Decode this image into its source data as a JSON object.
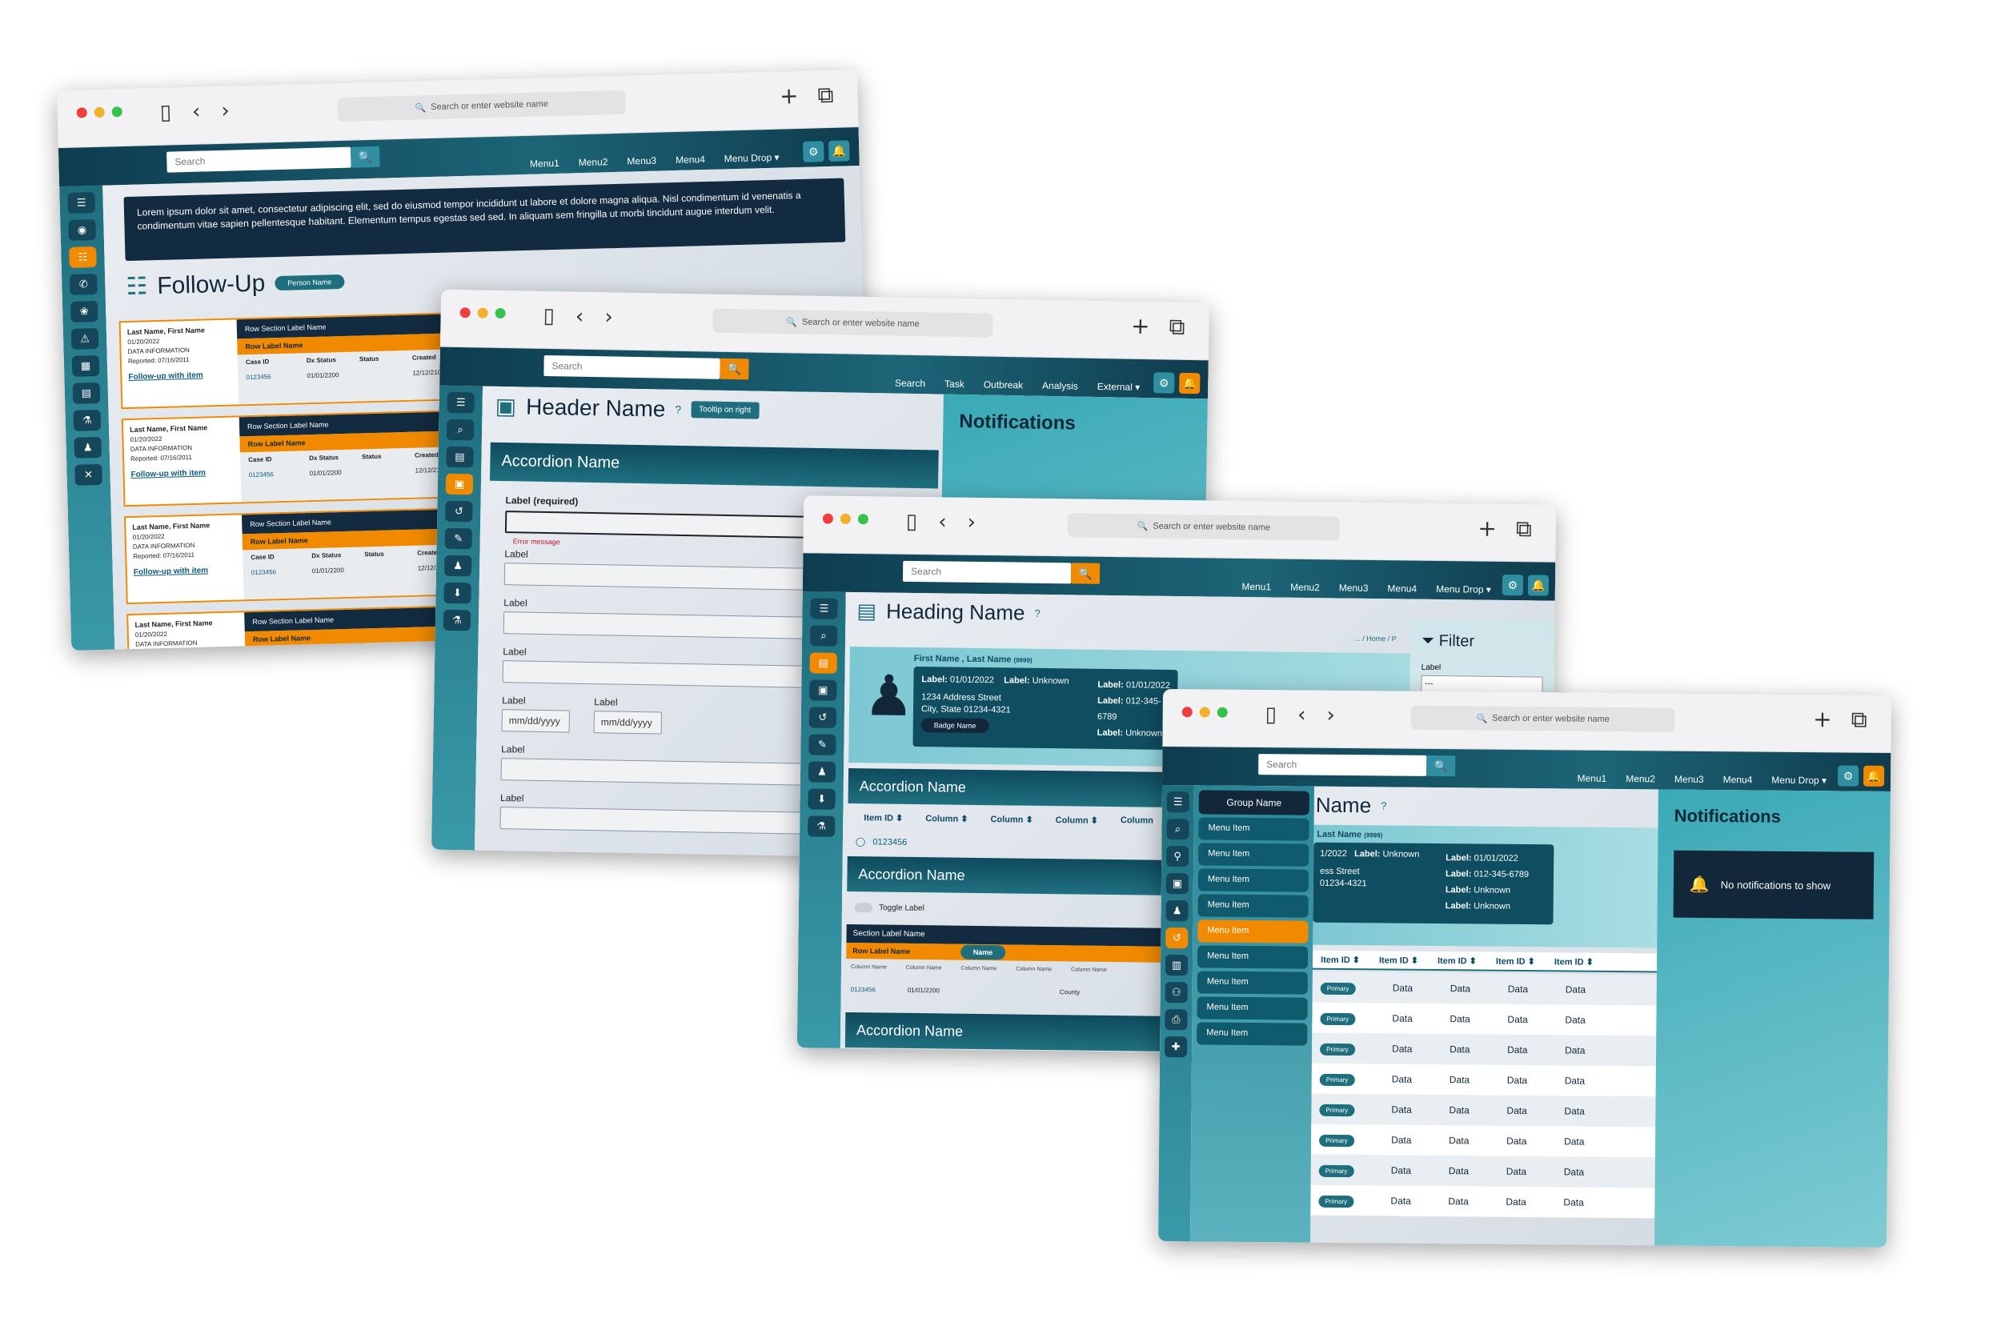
{
  "browser": {
    "url_placeholder": "Search or enter website name",
    "plus_icon": "+",
    "tabs_icon": "⧉"
  },
  "w1": {
    "search_placeholder": "Search",
    "menus": [
      "Menu1",
      "Menu2",
      "Menu3",
      "Menu4",
      "Menu Drop ▾"
    ],
    "banner": "Lorem ipsum dolor sit amet, consectetur adipiscing elit, sed do eiusmod tempor incididunt ut labore et dolore magna aliqua. Nisl condimentum id venenatis a condimentum vitae sapien pellentesque habitant. Elementum tempus egestas sed sed. In aliquam sem fringilla ut morbi tincidunt augue interdum velit.",
    "title": "Follow-Up",
    "person_pill": "Person Name",
    "cards": [
      {
        "name": "Last Name, First Name",
        "date": "01/20/2022",
        "info": "DATA INFORMATION",
        "reported": "Reported: 07/16/2011",
        "link": "Follow-up with item",
        "section": "Row Section Label Name",
        "row": "Row Label Name",
        "h1": "Case ID",
        "h2": "Dx Status",
        "h3": "Status",
        "h4": "Created",
        "c1": "0123456",
        "c2": "01/01/2200",
        "c3": "",
        "c4": "12/12/2100"
      },
      {
        "name": "Last Name, First Name",
        "date": "01/20/2022",
        "info": "DATA INFORMATION",
        "reported": "Reported: 07/16/2011",
        "link": "Follow-up with item",
        "section": "Row Section Label Name",
        "row": "Row Label Name",
        "h1": "Case ID",
        "h2": "Dx Status",
        "h3": "Status",
        "h4": "Created",
        "c1": "0123456",
        "c2": "01/01/2200",
        "c3": "",
        "c4": "12/12/2100"
      },
      {
        "name": "Last Name, First Name",
        "date": "01/20/2022",
        "info": "DATA INFORMATION",
        "reported": "Reported: 07/16/2011",
        "link": "Follow-up with item",
        "section": "Row Section Label Name",
        "row": "Row Label Name",
        "h1": "Case ID",
        "h2": "Dx Status",
        "h3": "Status",
        "h4": "Created",
        "c1": "0123456",
        "c2": "01/01/2200",
        "c3": "",
        "c4": "12/12/2100"
      },
      {
        "name": "Last Name, First Name",
        "date": "01/20/2022",
        "info": "DATA INFORMATION",
        "reported": "",
        "link": "",
        "section": "Row Section Label Name",
        "row": "Row Label Name",
        "h1": "",
        "h2": "",
        "h3": "",
        "h4": "",
        "c1": "",
        "c2": "",
        "c3": "",
        "c4": ""
      }
    ]
  },
  "w2": {
    "search_placeholder": "Search",
    "menus": [
      "Search",
      "Task",
      "Outbreak",
      "Analysis",
      "External ▾"
    ],
    "header": "Header Name",
    "tooltip": "Tooltip on right",
    "accordion": "Accordion Name",
    "label_required": "Label (required)",
    "error": "Error message",
    "label": "Label",
    "date_placeholder": "mm/dd/yyyy",
    "notifications": "Notifications"
  },
  "w3": {
    "search_placeholder": "Search",
    "menus": [
      "Menu1",
      "Menu2",
      "Menu3",
      "Menu4",
      "Menu Drop ▾"
    ],
    "heading": "Heading Name",
    "breadcrumb": "... / Home / P",
    "filter": "Filter",
    "filter_label": "Label",
    "filter_select": "---",
    "person_name": "First Name , Last Name",
    "person_id": "(9999)",
    "label1": "Label:",
    "val_date": "01/01/2022",
    "val_unknown": "Unknown",
    "address1": "1234 Address Street",
    "address2": "City, State 01234-4321",
    "badge": "Badge Name",
    "phone": "012-345-6789",
    "accordion1": "Accordion Name",
    "accordion2": "Accordion Name",
    "accordion3": "Accordion Name",
    "cols": [
      "Item ID ⬍",
      "Column ⬍",
      "Column ⬍",
      "Column ⬍",
      "Column"
    ],
    "item": "0123456",
    "toggle": "Toggle Label",
    "section_label": "Section Label Name",
    "row_label": "Row Label Name",
    "name_pill": "Name",
    "col_name": "Column Name",
    "row_id": "0123456",
    "row_date": "01/01/2200",
    "row_county": "County"
  },
  "w4": {
    "search_placeholder": "Search",
    "menus": [
      "Menu1",
      "Menu2",
      "Menu3",
      "Menu4",
      "Menu Drop ▾"
    ],
    "group": "Group Name",
    "menu_items": [
      "Menu Item",
      "Menu Item",
      "Menu Item",
      "Menu Item",
      "Menu Item",
      "Menu Item",
      "Menu Item",
      "Menu Item",
      "Menu Item"
    ],
    "active_index": 4,
    "heading_fragment": "Name",
    "name_fragment": "Last Name",
    "name_id": "(9999)",
    "frag_date": "1/2022",
    "frag_label": "Label:",
    "frag_unknown": "Unknown",
    "frag_street": "ess Street",
    "frag_city": "01234-4321",
    "card_label": "Label:",
    "card_date": "01/01/2022",
    "card_phone": "012-345-6789",
    "card_unknown": "Unknown",
    "notifications": "Notifications",
    "no_notifications": "No notifications to show",
    "cols": [
      "Item ID ⬍",
      "Item ID ⬍",
      "Item ID ⬍",
      "Item ID ⬍",
      "Item ID ⬍"
    ],
    "primary": "Primary",
    "data": "Data"
  }
}
